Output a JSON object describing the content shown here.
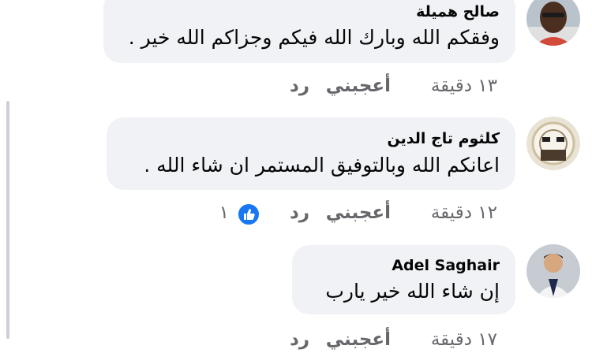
{
  "comments": [
    {
      "author": "صالح هميلة",
      "text": "وفقكم الله وبارك الله فيكم وجزاكم الله خير .",
      "time": "١٣ دقيقة",
      "like_label": "أعجبني",
      "reply_label": "رد"
    },
    {
      "author": "كلثوم تاج الدين",
      "text": "اعانكم الله وبالتوفيق المستمر ان شاء الله .",
      "time": "١٢ دقيقة",
      "like_label": "أعجبني",
      "reply_label": "رد",
      "reaction_count": "١"
    },
    {
      "author": "Adel Saghair",
      "text": "إن شاء الله خير يارب",
      "time": "١٧ دقيقة",
      "like_label": "أعجبني",
      "reply_label": "رد"
    }
  ],
  "colors": {
    "bubble": "#f0f2f5",
    "secondary_text": "#65676b",
    "like_blue": "#1877f2",
    "thread_line": "#ccd0d5"
  }
}
